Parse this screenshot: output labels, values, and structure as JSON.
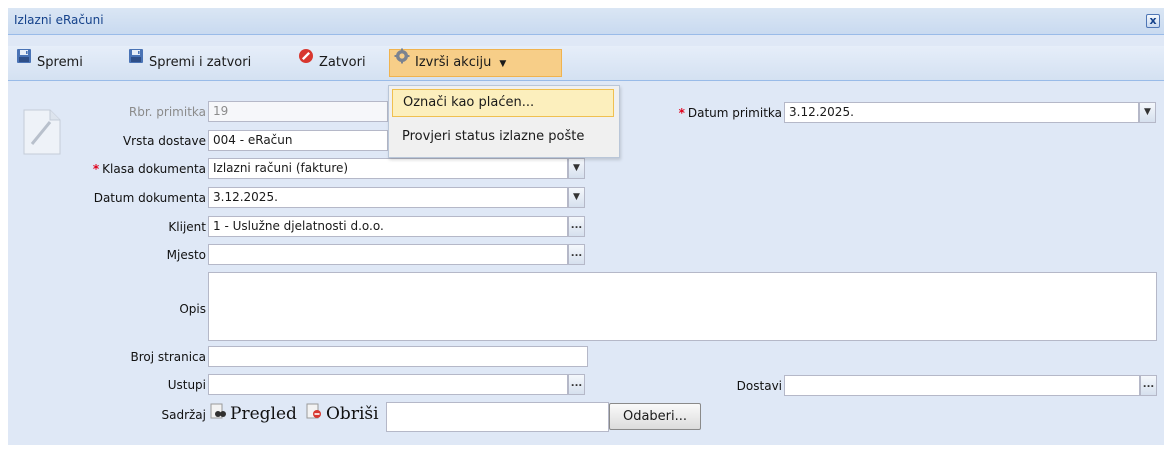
{
  "window": {
    "title": "Izlazni eRačuni",
    "close_label": "x"
  },
  "toolbar": {
    "save": "Spremi",
    "save_close": "Spremi i zatvori",
    "close": "Zatvori",
    "action": "Izvrši akciju"
  },
  "action_menu": {
    "items": [
      "Označi kao plaćen...",
      "Provjeri status izlazne pošte"
    ]
  },
  "form": {
    "rbr_label": "Rbr. primitka",
    "rbr_value": "19",
    "datum_primitka_label": "Datum primitka",
    "datum_primitka_value": "3.12.2025.",
    "vrsta_label": "Vrsta dostave",
    "vrsta_value": "004 - eRačun",
    "klasa_label": "Klasa dokumenta",
    "klasa_value": "Izlazni računi (fakture)",
    "datum_dok_label": "Datum dokumenta",
    "datum_dok_value": "3.12.2025.",
    "klijent_label": "Klijent",
    "klijent_value": "1 - Uslužne djelatnosti d.o.o.",
    "mjesto_label": "Mjesto",
    "mjesto_value": "",
    "opis_label": "Opis",
    "opis_value": "",
    "broj_label": "Broj stranica",
    "broj_value": "",
    "ustupi_label": "Ustupi",
    "ustupi_value": "",
    "dostavi_label": "Dostavi",
    "dostavi_value": "",
    "sadrzaj_label": "Sadržaj",
    "pregled": "Pregled",
    "obrisi": "Obriši",
    "odaberi": "Odaberi...",
    "file_value": ""
  },
  "icons": {
    "save": "floppy-disk-icon",
    "close": "red-stop-icon",
    "action": "gear-icon",
    "pregled": "binoculars-icon",
    "obrisi": "delete-document-icon"
  },
  "colors": {
    "window_bg": "#dfe8f6",
    "accent_active": "#f7ce88",
    "required": "#e0001b",
    "title": "#15428b"
  }
}
